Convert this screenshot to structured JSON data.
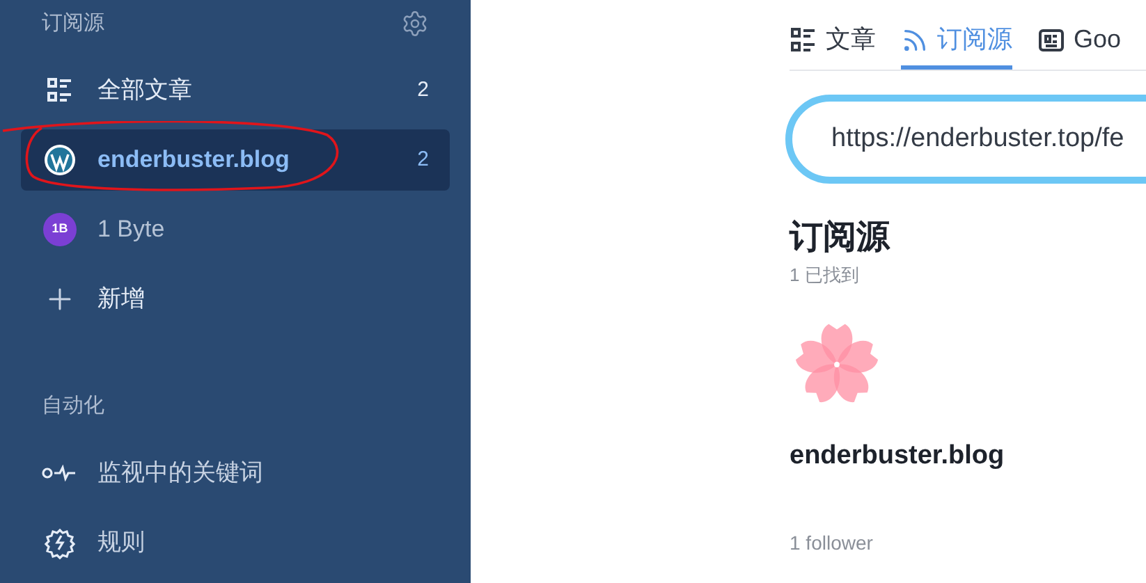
{
  "sidebar": {
    "section_title": "订阅源",
    "items": [
      {
        "kind": "all",
        "label": "全部文章",
        "count": "2",
        "selected": false
      },
      {
        "kind": "wordpress",
        "label": "enderbuster.blog",
        "count": "2",
        "selected": true,
        "annotated": true
      },
      {
        "kind": "avatar",
        "avatar": "1B",
        "label": "1 Byte",
        "selected": false
      },
      {
        "kind": "add",
        "label": "新增",
        "selected": false
      }
    ],
    "automation_title": "自动化",
    "automation_items": [
      {
        "kind": "keywords",
        "label": "监视中的关键词"
      },
      {
        "kind": "rules",
        "label": "规则"
      }
    ]
  },
  "tabs": [
    {
      "kind": "articles",
      "label": "文章",
      "selected": false
    },
    {
      "kind": "feeds",
      "label": "订阅源",
      "selected": true
    },
    {
      "kind": "google",
      "label": "Goo",
      "selected": false
    }
  ],
  "search": {
    "value": "https://enderbuster.top/fe"
  },
  "results": {
    "title": "订阅源",
    "count": "1 已找到",
    "feed": {
      "name": "enderbuster.blog",
      "followers": "1 follower"
    }
  }
}
